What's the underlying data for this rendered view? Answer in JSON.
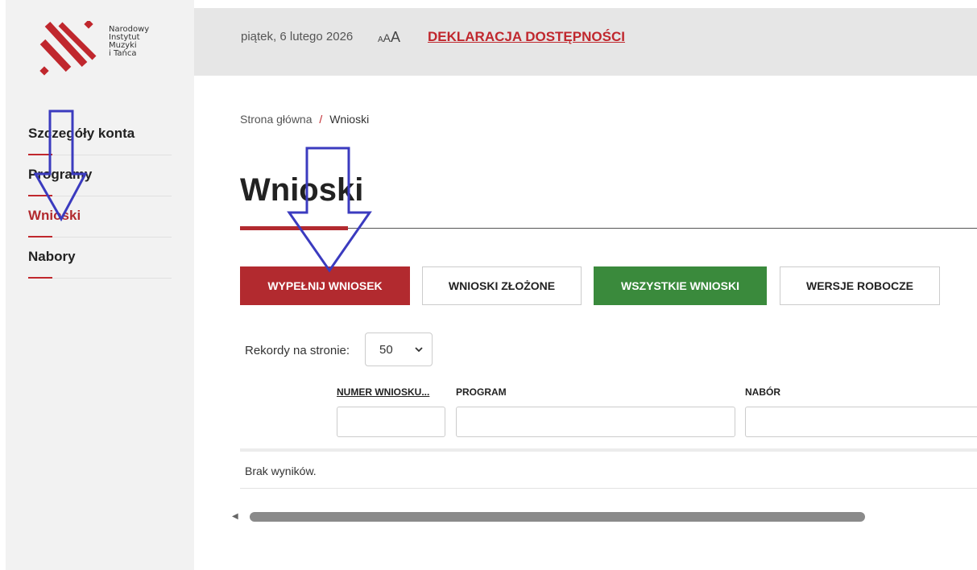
{
  "logo": {
    "lines": [
      "Narodowy",
      "Instytut",
      "Muzyki",
      "i Tańca"
    ],
    "brand_color": "#c0272d"
  },
  "topbar": {
    "date": "piątek, 6 lutego 2026",
    "font_sizes": [
      "A",
      "A",
      "A"
    ],
    "accessibility_link": "DEKLARACJA DOSTĘPNOŚCI"
  },
  "sidebar": {
    "items": [
      {
        "label": "Szczegóły konta",
        "active": false
      },
      {
        "label": "Programy",
        "active": false
      },
      {
        "label": "Wnioski",
        "active": true
      },
      {
        "label": "Nabory",
        "active": false
      }
    ]
  },
  "breadcrumb": {
    "home": "Strona główna",
    "separator": "/",
    "current": "Wnioski"
  },
  "page_title": "Wnioski",
  "buttons": {
    "fill": "WYPEŁNIJ WNIOSEK",
    "submitted": "WNIOSKI ZŁOŻONE",
    "all": "WSZYSTKIE WNIOSKI",
    "drafts": "WERSJE ROBOCZE"
  },
  "pagination": {
    "label": "Rekordy na stronie:",
    "selected": "50"
  },
  "table": {
    "columns": [
      "NUMER WNIOSKU...",
      "PROGRAM",
      "NABÓR"
    ],
    "empty_message": "Brak wyników."
  },
  "colors": {
    "accent_red": "#b22a2f",
    "accent_green": "#3a8a3c",
    "annotation_blue": "#3b3bbf"
  }
}
